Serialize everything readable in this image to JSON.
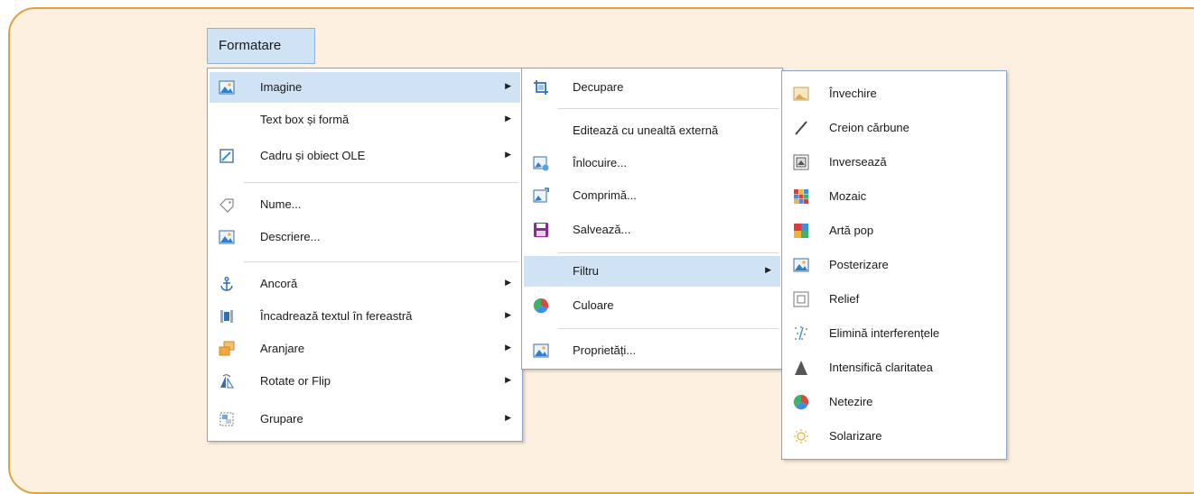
{
  "menubar": {
    "label": "Formatare"
  },
  "main_menu": {
    "items": [
      {
        "label": "Imagine",
        "icon": "image-icon",
        "submenu": true,
        "highlighted": true
      },
      {
        "label": "Text box și formă",
        "icon": "",
        "submenu": true
      },
      {
        "label": "Cadru și obiect OLE",
        "icon": "frame-icon",
        "submenu": true
      },
      {
        "label": "Nume...",
        "icon": "tag-icon",
        "submenu": false
      },
      {
        "label": "Descriere...",
        "icon": "image-icon",
        "submenu": false
      },
      {
        "label": "Ancoră",
        "icon": "anchor-icon",
        "submenu": true
      },
      {
        "label": "Încadrează textul în fereastră",
        "icon": "wrap-icon",
        "submenu": true
      },
      {
        "label": "Aranjare",
        "icon": "arrange-icon",
        "submenu": true
      },
      {
        "label": "Rotate or Flip",
        "icon": "rotate-icon",
        "submenu": true
      },
      {
        "label": "Grupare",
        "icon": "group-icon",
        "submenu": true
      }
    ]
  },
  "image_menu": {
    "items": [
      {
        "label": "Decupare",
        "icon": "crop-icon"
      },
      {
        "label": "Editează cu unealtă externă",
        "icon": ""
      },
      {
        "label": "Înlocuire...",
        "icon": "replace-image-icon"
      },
      {
        "label": "Comprimă...",
        "icon": "compress-image-icon"
      },
      {
        "label": "Salvează...",
        "icon": "save-icon"
      },
      {
        "label": "Filtru",
        "icon": "",
        "submenu": true,
        "highlighted": true
      },
      {
        "label": "Culoare",
        "icon": "color-icon"
      },
      {
        "label": "Proprietăți...",
        "icon": "image-icon"
      }
    ]
  },
  "filter_menu": {
    "items": [
      {
        "label": "Învechire",
        "icon": "aging-icon"
      },
      {
        "label": "Creion cărbune",
        "icon": "charcoal-pencil-icon"
      },
      {
        "label": "Inversează",
        "icon": "invert-icon"
      },
      {
        "label": "Mozaic",
        "icon": "mosaic-icon"
      },
      {
        "label": "Artă pop",
        "icon": "pop-art-icon"
      },
      {
        "label": "Posterizare",
        "icon": "posterize-icon"
      },
      {
        "label": "Relief",
        "icon": "relief-icon"
      },
      {
        "label": "Elimină interferențele",
        "icon": "remove-noise-icon"
      },
      {
        "label": "Intensifică claritatea",
        "icon": "sharpen-icon"
      },
      {
        "label": "Netezire",
        "icon": "smooth-icon"
      },
      {
        "label": "Solarizare",
        "icon": "solarize-icon"
      }
    ]
  },
  "colors": {
    "panel_bg": "#fdf0e1",
    "panel_border": "#e2a13a",
    "highlight": "#cfe3f5",
    "menu_border": "#8aa3c4"
  }
}
